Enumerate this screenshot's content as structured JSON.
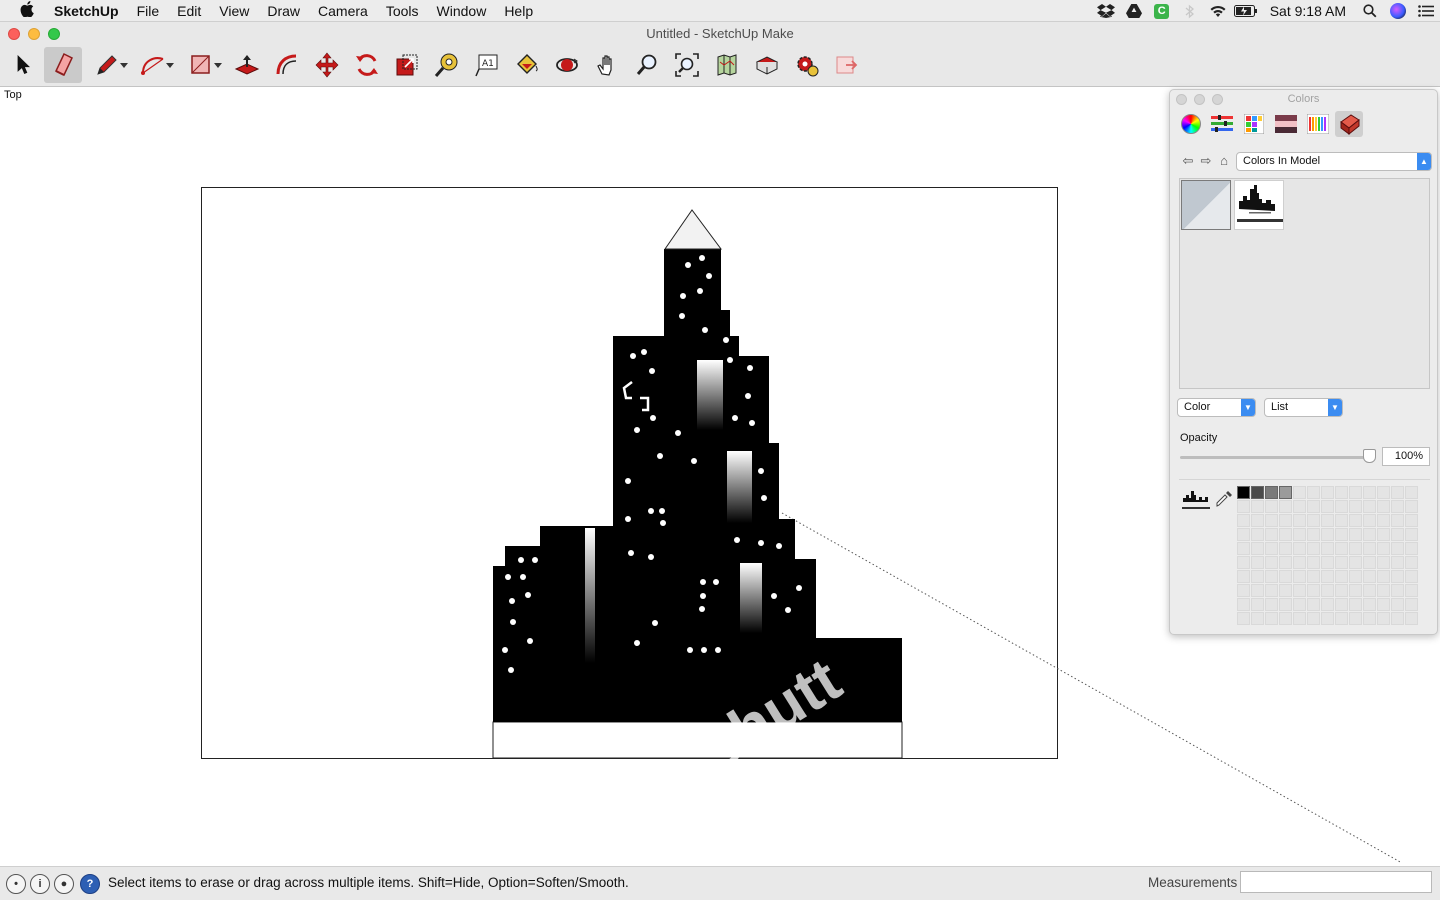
{
  "menubar": {
    "app_name": "SketchUp",
    "items": [
      "File",
      "Edit",
      "View",
      "Draw",
      "Camera",
      "Tools",
      "Window",
      "Help"
    ],
    "clock": "Sat 9:18 AM"
  },
  "window": {
    "title": "Untitled - SketchUp Make"
  },
  "toolbar": {
    "tools": [
      "select",
      "eraser",
      "line",
      "arc",
      "rectangle",
      "push-pull",
      "offset",
      "move",
      "rotate",
      "scale",
      "tape-measure",
      "text",
      "paint-bucket",
      "orbit",
      "pan",
      "zoom",
      "zoom-extents",
      "3d-warehouse",
      "extension-warehouse",
      "layout",
      "send-to-layout"
    ],
    "active_tool": "eraser"
  },
  "canvas": {
    "view_label": "Top",
    "watermark": "shutt"
  },
  "colors_panel": {
    "title": "Colors",
    "library": "Colors In Model",
    "mode_select": "Color",
    "view_select": "List",
    "opacity_label": "Opacity",
    "opacity_value": "100%",
    "opacity_level": 1.0,
    "recent_colors": [
      "#000000",
      "#4a4a4a",
      "#7a7a7a",
      "#9b9b9b"
    ]
  },
  "statusbar": {
    "message": "Select items to erase or drag across multiple items. Shift=Hide, Option=Soften/Smooth.",
    "measurements_label": "Measurements",
    "measurements_value": ""
  },
  "colors": {
    "accent": "#3b8cf1",
    "close": "#fc605c",
    "minimize": "#fdbc40",
    "maximize": "#34c84a"
  }
}
